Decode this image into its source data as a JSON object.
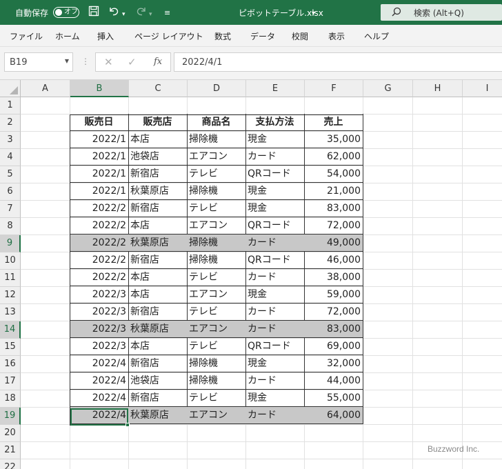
{
  "titlebar": {
    "autosave_label": "自動保存",
    "autosave_state": "オフ",
    "filename": "ピボットテーブル.xlsx",
    "search_placeholder": "検索 (Alt+Q)"
  },
  "ribbon": {
    "tabs": [
      "ファイル",
      "ホーム",
      "挿入",
      "ページ レイアウト",
      "数式",
      "データ",
      "校閲",
      "表示",
      "ヘルプ"
    ]
  },
  "formula_bar": {
    "name_box": "B19",
    "formula": "2022/4/1"
  },
  "grid": {
    "columns": [
      "A",
      "B",
      "C",
      "D",
      "E",
      "F",
      "G",
      "H",
      "I"
    ],
    "rows": [
      "1",
      "2",
      "3",
      "4",
      "5",
      "6",
      "7",
      "8",
      "9",
      "10",
      "11",
      "12",
      "13",
      "14",
      "15",
      "16",
      "17",
      "18",
      "19",
      "20",
      "21",
      "22"
    ],
    "selected_column": "B",
    "selected_rows": [
      "9",
      "14",
      "19"
    ],
    "active_cell": "B19"
  },
  "table": {
    "headers": [
      "販売日",
      "販売店",
      "商品名",
      "支払方法",
      "売上"
    ],
    "rows": [
      [
        "2022/1",
        "本店",
        "掃除機",
        "現金",
        "35,000"
      ],
      [
        "2022/1",
        "池袋店",
        "エアコン",
        "カード",
        "62,000"
      ],
      [
        "2022/1",
        "新宿店",
        "テレビ",
        "QRコード",
        "54,000"
      ],
      [
        "2022/1",
        "秋葉原店",
        "掃除機",
        "現金",
        "21,000"
      ],
      [
        "2022/2",
        "新宿店",
        "テレビ",
        "現金",
        "83,000"
      ],
      [
        "2022/2",
        "本店",
        "エアコン",
        "QRコード",
        "72,000"
      ],
      [
        "2022/2",
        "秋葉原店",
        "掃除機",
        "カード",
        "49,000"
      ],
      [
        "2022/2",
        "新宿店",
        "掃除機",
        "QRコード",
        "46,000"
      ],
      [
        "2022/2",
        "本店",
        "テレビ",
        "カード",
        "38,000"
      ],
      [
        "2022/3",
        "本店",
        "エアコン",
        "現金",
        "59,000"
      ],
      [
        "2022/3",
        "新宿店",
        "テレビ",
        "カード",
        "72,000"
      ],
      [
        "2022/3",
        "秋葉原店",
        "エアコン",
        "カード",
        "83,000"
      ],
      [
        "2022/3",
        "本店",
        "テレビ",
        "QRコード",
        "69,000"
      ],
      [
        "2022/4",
        "新宿店",
        "掃除機",
        "現金",
        "32,000"
      ],
      [
        "2022/4",
        "池袋店",
        "掃除機",
        "カード",
        "44,000"
      ],
      [
        "2022/4",
        "新宿店",
        "テレビ",
        "現金",
        "55,000"
      ],
      [
        "2022/4",
        "秋葉原店",
        "エアコン",
        "カード",
        "64,000"
      ]
    ],
    "highlighted_rows": [
      6,
      11,
      16
    ],
    "highlight_color": "#c8c8c8"
  },
  "watermark": "Buzzword Inc.",
  "colors": {
    "brand": "#217346",
    "ribbon_bg": "#f3f3f3",
    "header_bg": "#efefef",
    "highlight": "#c8c8c8"
  }
}
